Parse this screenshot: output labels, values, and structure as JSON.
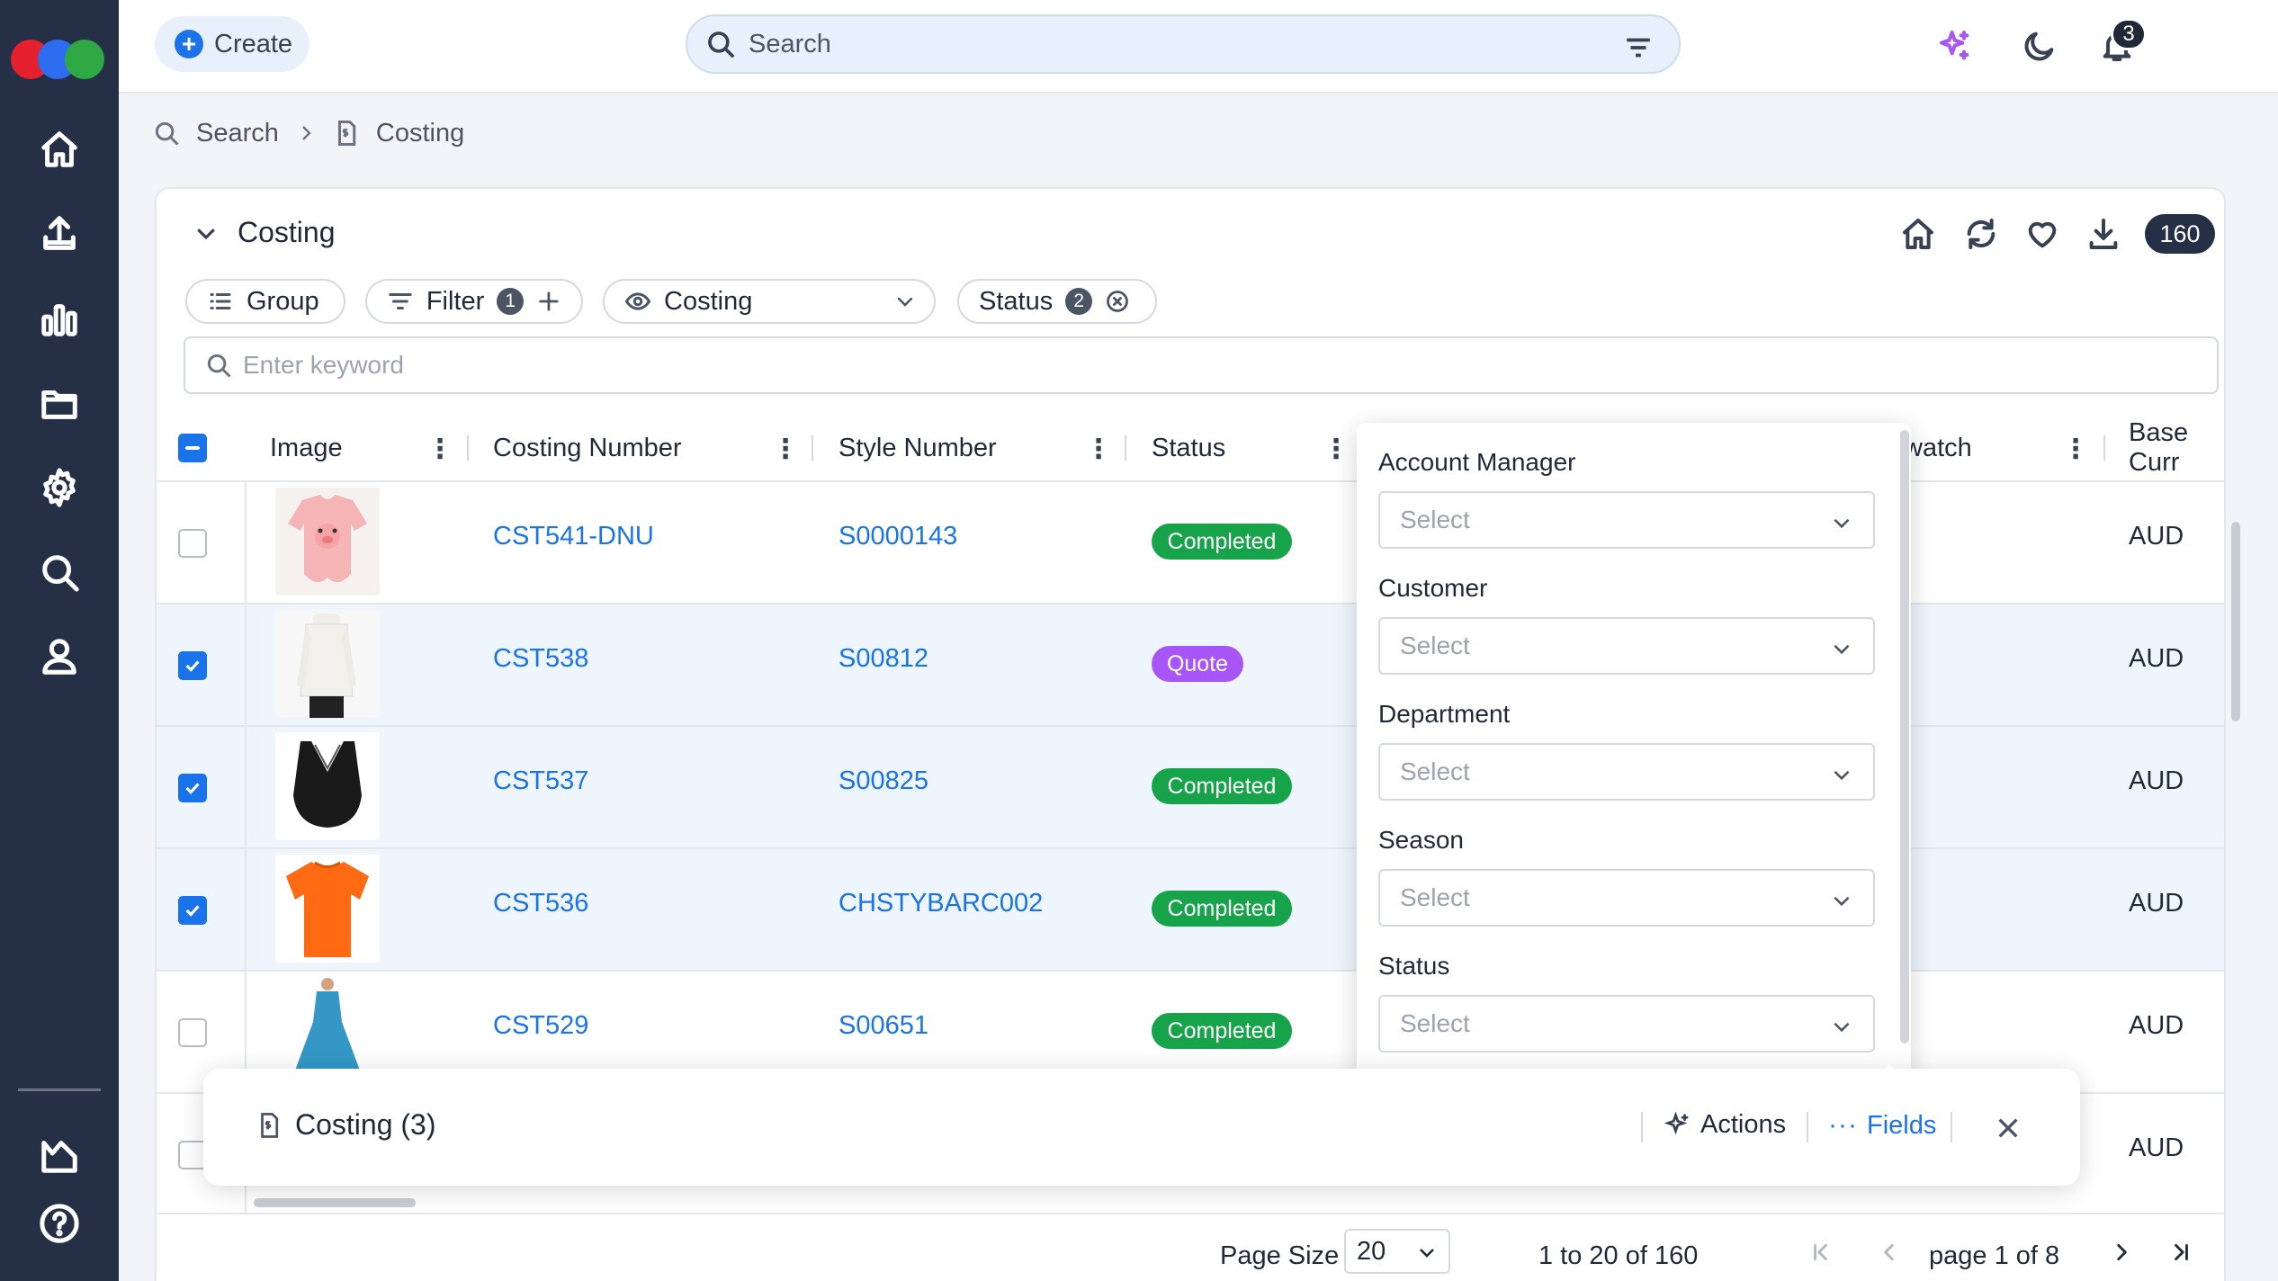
{
  "sidebar": {
    "items": [
      {
        "name": "home"
      },
      {
        "name": "upload"
      },
      {
        "name": "reports"
      },
      {
        "name": "folder"
      },
      {
        "name": "settings"
      },
      {
        "name": "search"
      },
      {
        "name": "user"
      },
      {
        "name": "analytics"
      },
      {
        "name": "help"
      }
    ]
  },
  "topbar": {
    "create_label": "Create",
    "search_placeholder": "Search",
    "notification_count": "3"
  },
  "breadcrumb": {
    "items": [
      "Search",
      "Costing"
    ]
  },
  "panel": {
    "title": "Costing",
    "record_count": "160",
    "chips": {
      "group_label": "Group",
      "filter_label": "Filter",
      "filter_count": "1",
      "view_label": "Costing",
      "status_label": "Status",
      "status_count": "2"
    },
    "keyword_placeholder": "Enter keyword"
  },
  "table": {
    "columns": [
      "Image",
      "Costing Number",
      "Style Number",
      "Status",
      "watch",
      "Base Curr"
    ],
    "rows": [
      {
        "costing_number": "CST541-DNU",
        "style_number": "S0000143",
        "status": "Completed",
        "base_currency": "AUD",
        "selected": false
      },
      {
        "costing_number": "CST538",
        "style_number": "S00812",
        "status": "Quote",
        "base_currency": "AUD",
        "selected": true
      },
      {
        "costing_number": "CST537",
        "style_number": "S00825",
        "status": "Completed",
        "base_currency": "AUD",
        "selected": true
      },
      {
        "costing_number": "CST536",
        "style_number": "CHSTYBARC002",
        "status": "Completed",
        "base_currency": "AUD",
        "selected": true
      },
      {
        "costing_number": "CST529",
        "style_number": "S00651",
        "status": "Completed",
        "base_currency": "AUD",
        "selected": false
      },
      {
        "costing_number": "",
        "style_number": "",
        "status": "",
        "base_currency": "AUD",
        "selected": false
      }
    ]
  },
  "fields_popup": {
    "fields": [
      {
        "label": "Account Manager",
        "placeholder": "Select"
      },
      {
        "label": "Customer",
        "placeholder": "Select"
      },
      {
        "label": "Department",
        "placeholder": "Select"
      },
      {
        "label": "Season",
        "placeholder": "Select"
      },
      {
        "label": "Status",
        "placeholder": "Select"
      }
    ]
  },
  "bottom_bar": {
    "title": "Costing (3)",
    "actions_label": "Actions",
    "fields_label": "Fields"
  },
  "footer": {
    "page_size_label": "Page Size",
    "page_size_value": "20",
    "range_text": "1 to 20 of 160",
    "page_text_prefix": "page",
    "page_current": "1",
    "page_text_of": "of",
    "page_total": "8"
  },
  "colors": {
    "sidebar_bg": "#253047",
    "accent": "#1a73e8",
    "completed": "#16a34a",
    "quote": "#a855f7"
  }
}
